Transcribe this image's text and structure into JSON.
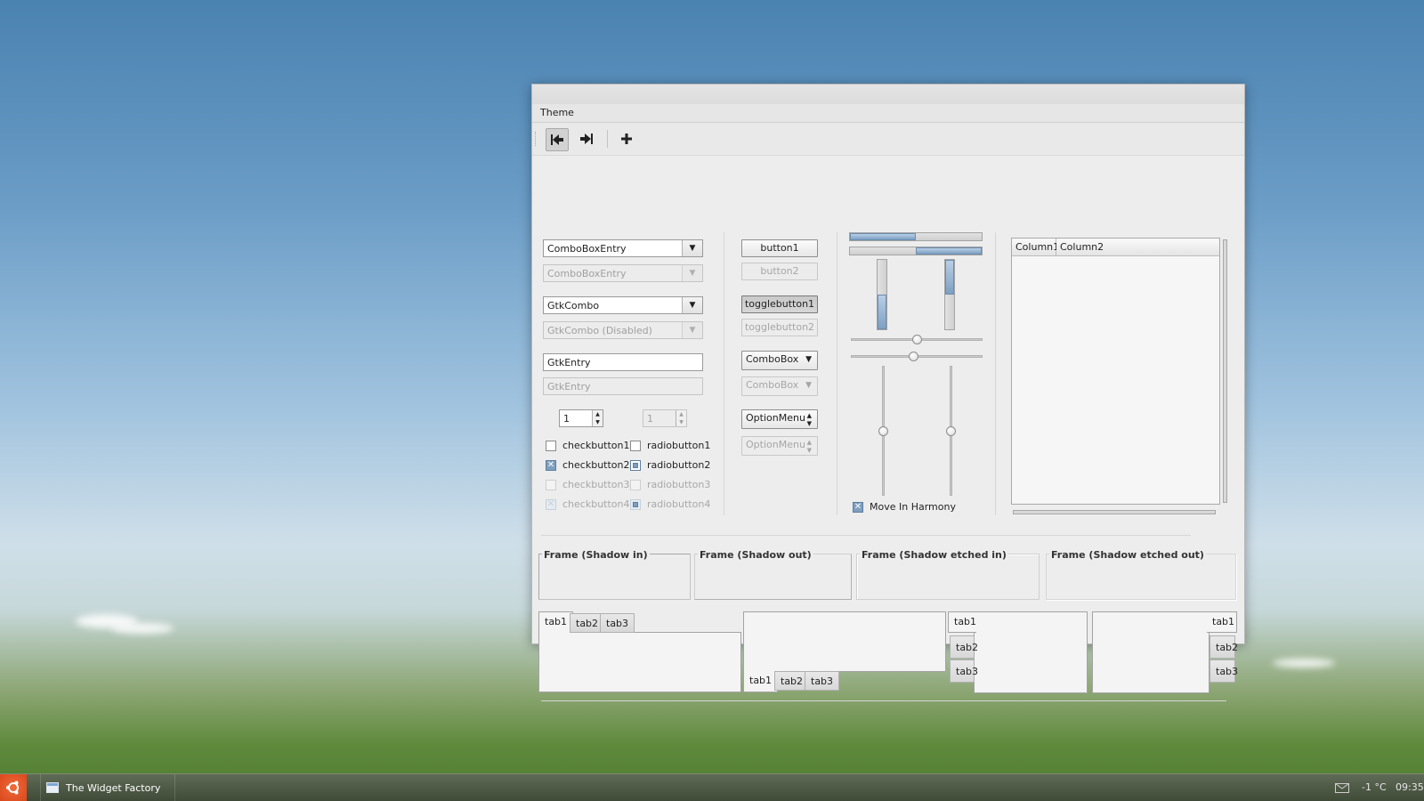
{
  "window": {
    "menu": "Theme",
    "toolbar_icons": {
      "first": "skip-first-icon",
      "last": "skip-last-icon",
      "add": "plus-icon"
    }
  },
  "left": {
    "combo_entry": "ComboBoxEntry",
    "combo_entry_disabled": "ComboBoxEntry",
    "gtk_combo": "GtkCombo",
    "gtk_combo_disabled": "GtkCombo (Disabled)",
    "entry": "GtkEntry",
    "entry_disabled": "GtkEntry",
    "spin": "1",
    "spin_disabled": "1",
    "checks": [
      "checkbutton1",
      "checkbutton2",
      "checkbutton3",
      "checkbutton4"
    ],
    "radios": [
      "radiobutton1",
      "radiobutton2",
      "radiobutton3",
      "radiobutton4"
    ]
  },
  "buttons": {
    "button1": "button1",
    "button2": "button2",
    "toggle1": "togglebutton1",
    "toggle2": "togglebutton2",
    "combobox": "ComboBox",
    "combobox_disabled": "ComboBox",
    "optionmenu": "OptionMenu",
    "optionmenu_disabled": "OptionMenu"
  },
  "ranges": {
    "move_in_harmony": "Move In Harmony",
    "progress_h1": 0.5,
    "progress_h2": 0.5,
    "progress_v1": 0.5,
    "progress_v2": 0.5,
    "hscale1": 0.5,
    "hscale2": 0.5,
    "vscale1": 0.5,
    "vscale2": 0.5
  },
  "tree": {
    "columns": [
      "Column1",
      "Column2"
    ]
  },
  "frames": [
    "Frame (Shadow in)",
    "Frame (Shadow out)",
    "Frame (Shadow etched in)",
    "Frame (Shadow etched out)"
  ],
  "notebooks": {
    "tabs": [
      "tab1",
      "tab2",
      "tab3"
    ]
  },
  "taskbar": {
    "task": "The Widget Factory",
    "temperature": "-1 °C",
    "clock": "09:35",
    "icons": {
      "start": "ubuntu-logo-icon",
      "mail": "mail-icon"
    }
  }
}
